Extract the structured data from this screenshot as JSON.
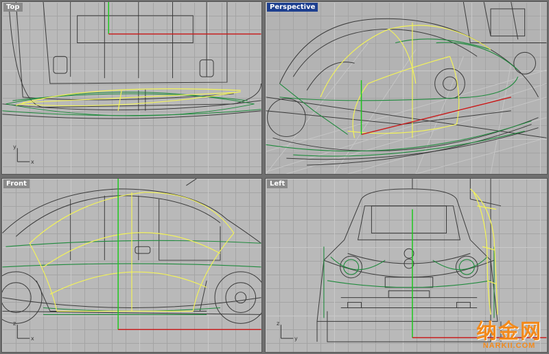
{
  "viewports": {
    "top": {
      "label": "Top"
    },
    "perspective": {
      "label": "Perspective"
    },
    "front": {
      "label": "Front"
    },
    "left": {
      "label": "Left"
    }
  },
  "axes": {
    "top": {
      "v": "y",
      "h": "x"
    },
    "front": {
      "v": "z",
      "h": "x"
    },
    "left": {
      "v": "z",
      "h": "y"
    }
  },
  "watermark": {
    "cn": "纳金网",
    "en": "NARKII.COM"
  },
  "colors": {
    "active_label": "#1d3f8f",
    "curve_yellow": "#f2f25a",
    "curve_green": "#1e8a3c",
    "axis_red": "#c81e1e",
    "axis_green": "#1ec81e"
  }
}
